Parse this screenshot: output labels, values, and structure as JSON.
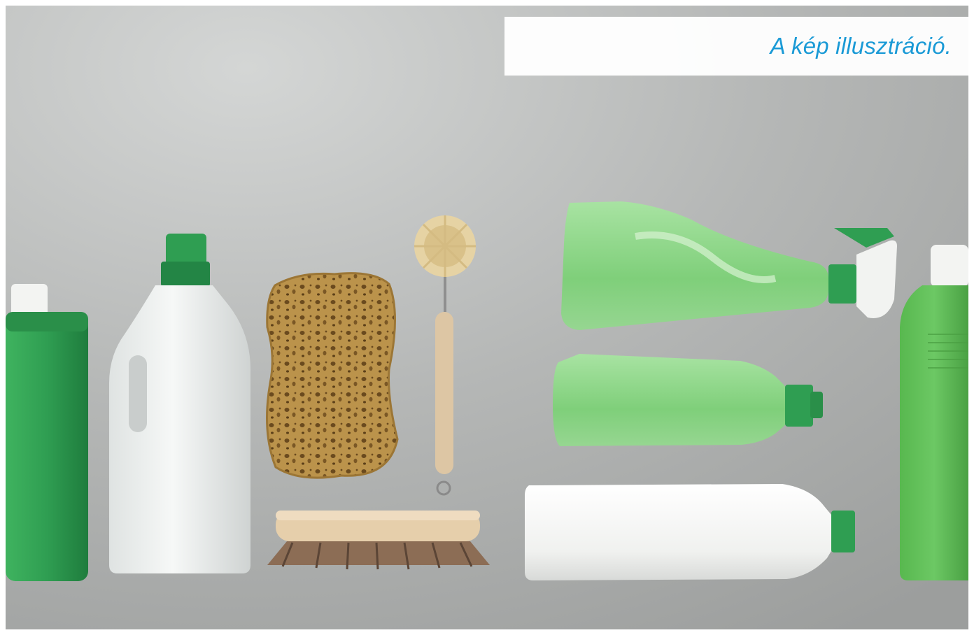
{
  "caption": {
    "text": "A kép illusztráció."
  },
  "colors": {
    "caption_text": "#1a9ad6",
    "background": "#a9abaa",
    "green": "#2f9e52",
    "light_green": "#62c35a",
    "white_plastic": "#f2f3f1",
    "sponge": "#b88f48",
    "wood": "#e3c9a3"
  },
  "objects": [
    "green-detergent-bottle",
    "translucent-white-jug",
    "natural-sponge",
    "dish-brush",
    "scrubbing-brush",
    "green-spray-bottle",
    "green-dish-soap-bottle",
    "white-cleaner-bottle",
    "light-green-bottle"
  ]
}
